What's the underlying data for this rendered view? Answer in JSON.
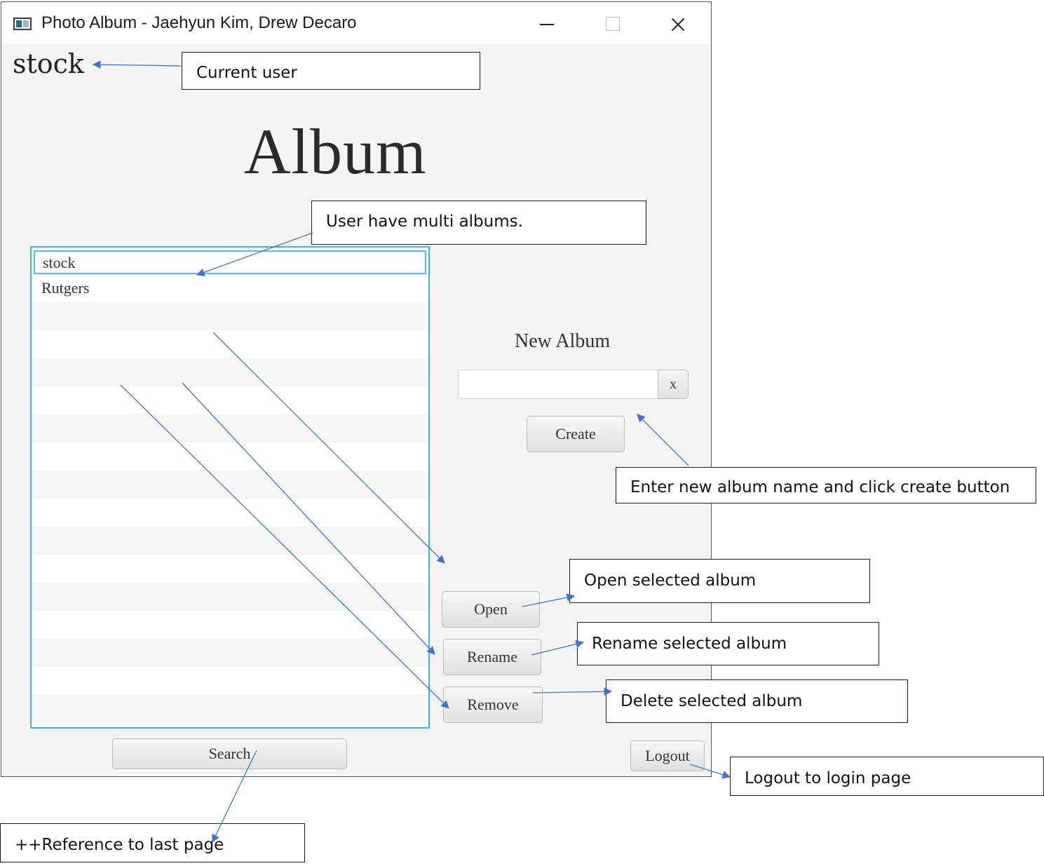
{
  "window": {
    "title": "Photo Album - Jaehyun Kim, Drew Decaro"
  },
  "current_user": "stock",
  "page_title": "Album",
  "albums": [
    {
      "name": "stock"
    },
    {
      "name": "Rutgers"
    }
  ],
  "new_album": {
    "label": "New Album",
    "input_value": "",
    "clear_label": "x",
    "create_label": "Create"
  },
  "actions": {
    "open_label": "Open",
    "rename_label": "Rename",
    "remove_label": "Remove",
    "search_label": "Search",
    "logout_label": "Logout"
  },
  "annotations": {
    "current_user": "Current user",
    "multi_albums": "User have multi albums.",
    "create": "Enter new album name and click create button",
    "open": "Open selected album",
    "rename": "Rename selected album",
    "delete": "Delete selected album",
    "logout": "Logout to login page",
    "search": "++Reference to last page"
  },
  "colors": {
    "list_border": "#3fb3e0",
    "arrow": "#4472c4",
    "window_bg": "#f4f4f4"
  }
}
